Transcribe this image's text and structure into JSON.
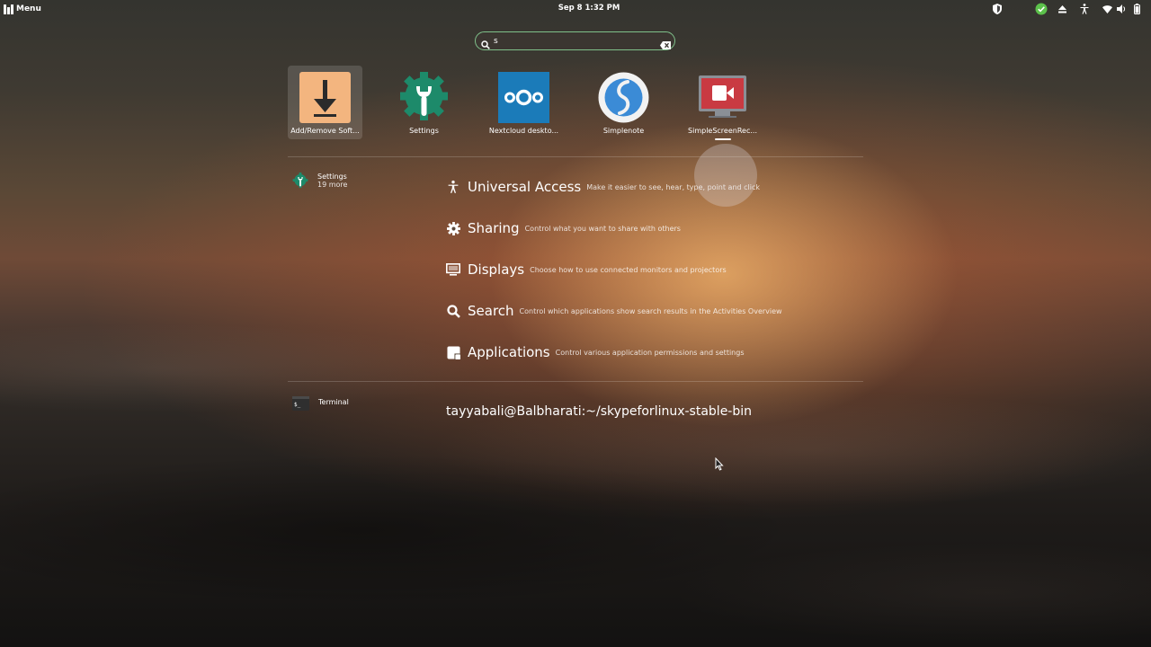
{
  "topbar": {
    "menu_label": "Menu",
    "clock": "Sep 8  1:32 PM",
    "tray_icons": [
      "shield-icon",
      "update-ok-icon",
      "eject-icon",
      "accessibility-icon",
      "wifi-icon",
      "volume-icon",
      "battery-icon"
    ]
  },
  "search": {
    "query": "s",
    "search_icon": "search-icon",
    "clear_icon": "clear-icon"
  },
  "apps": [
    {
      "label": "Add/Remove Soft...",
      "icon": "download-icon",
      "selected": true
    },
    {
      "label": "Settings",
      "icon": "settings-gear-icon"
    },
    {
      "label": "Nextcloud deskto...",
      "icon": "nextcloud-icon"
    },
    {
      "label": "Simplenote",
      "icon": "simplenote-icon"
    },
    {
      "label": "SimpleScreenRec...",
      "icon": "screen-recorder-icon",
      "running": true
    }
  ],
  "providers": {
    "settings": {
      "name": "Settings",
      "more": "19 more"
    },
    "terminal": {
      "name": "Terminal"
    }
  },
  "results": [
    {
      "title": "Universal Access",
      "desc": "Make it easier to see, hear, type, point and click",
      "icon": "accessibility-icon"
    },
    {
      "title": "Sharing",
      "desc": "Control what you want to share with others",
      "icon": "gear-icon"
    },
    {
      "title": "Displays",
      "desc": "Choose how to use connected monitors and projectors",
      "icon": "display-icon"
    },
    {
      "title": "Search",
      "desc": "Control which applications show search results in the Activities Overview",
      "icon": "search-icon"
    },
    {
      "title": "Applications",
      "desc": "Control various application permissions and settings",
      "icon": "applications-icon"
    }
  ],
  "terminal_result": "tayyabali@Balbharati:~/skypeforlinux-stable-bin",
  "colors": {
    "search_border": "#7fc08a",
    "settings_green": "#1d8a6a",
    "nextcloud_blue": "#1b7bb9",
    "simplenote_blue": "#3b8bd6",
    "recorder_red": "#c93a42",
    "addremove_peach": "#f3b57f"
  }
}
